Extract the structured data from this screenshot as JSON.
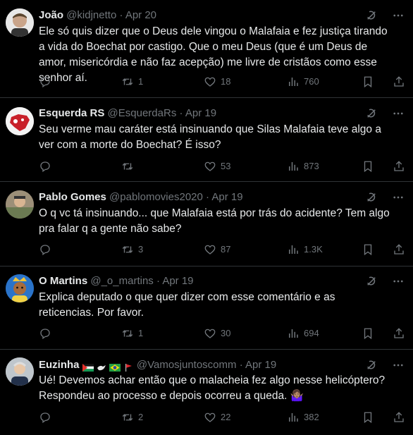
{
  "tweets": [
    {
      "name": "João",
      "handle": "@kidjnetto",
      "sep": "·",
      "date": "Apr 20",
      "text": "Ele só quis dizer que o Deus dele vingou o Malafaia e fez justiça tirando a vida do Boechat por castigo. Que o meu Deus (que é um Deus de amor, misericórdia e não faz acepção) me livre de cristãos como esse senhor aí.",
      "replies": "",
      "retweets": "1",
      "likes": "18",
      "views": "760"
    },
    {
      "name": "Esquerda RS",
      "handle": "@EsquerdaRs",
      "sep": "·",
      "date": "Apr 19",
      "text": "Seu verme mau caráter está insinuando que Silas Malafaia teve algo a ver com a morte do Boechat? É isso?",
      "replies": "",
      "retweets": "",
      "likes": "53",
      "views": "873"
    },
    {
      "name": "Pablo Gomes",
      "handle": "@pablomovies2020",
      "sep": "·",
      "date": "Apr 19",
      "text": "O q vc tá insinuando... que Malafaia está por trás do acidente? Tem algo pra falar q a gente não sabe?",
      "replies": "",
      "retweets": "3",
      "likes": "87",
      "views": "1.3K"
    },
    {
      "name": "O Martins",
      "handle": "@_o_martins",
      "sep": "·",
      "date": "Apr 19",
      "text": "Explica deputado o que quer dizer com esse comentário e as reticencias. Por favor.",
      "replies": "",
      "retweets": "1",
      "likes": "30",
      "views": "694"
    },
    {
      "name": "Euzinha",
      "handle": "@Vamosjuntoscomm",
      "sep": "·",
      "date": "Apr 19",
      "text": "Ué! Devemos achar então que o malacheia fez algo nesse helicóptero? Respondeu ao processo e depois ocorreu a queda. 🤷🏽‍♀️",
      "replies": "",
      "retweets": "2",
      "likes": "22",
      "views": "382"
    }
  ],
  "icons": {
    "grok": "grok-icon",
    "more": "more-icon",
    "reply": "reply-icon",
    "retweet": "retweet-icon",
    "like": "like-icon",
    "views": "views-icon",
    "bookmark": "bookmark-icon",
    "share": "share-icon"
  },
  "colors": {
    "background": "#000000",
    "text": "#e7e9ea",
    "muted": "#71767b",
    "border": "#2f3336"
  }
}
